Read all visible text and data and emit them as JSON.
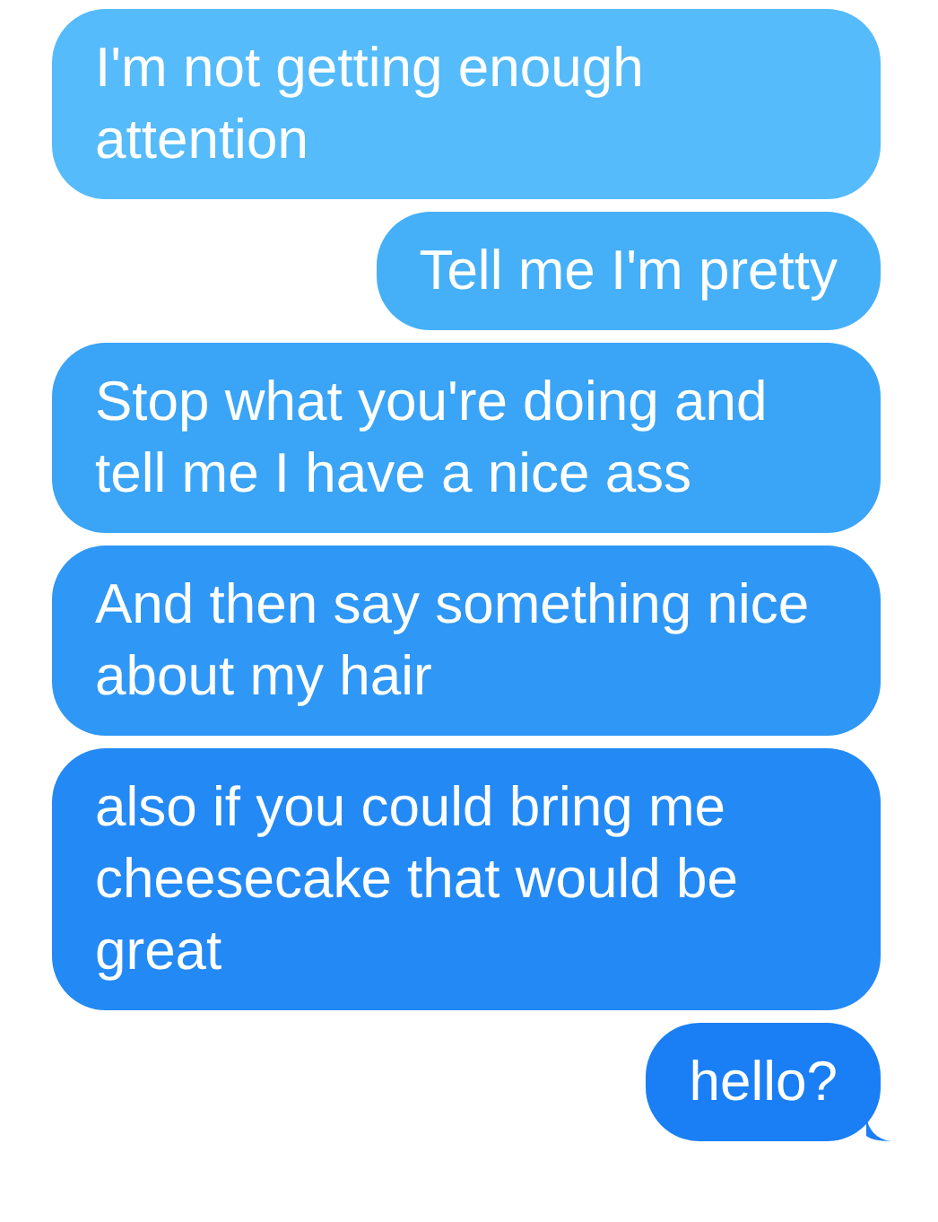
{
  "messages": [
    {
      "text": "I'm not getting enough attention"
    },
    {
      "text": "Tell me I'm pretty"
    },
    {
      "text": "Stop what you're doing and tell me I have a nice ass"
    },
    {
      "text": "And then say something nice about my hair"
    },
    {
      "text": "also if you could bring me cheesecake that would be great"
    },
    {
      "text": "hello?"
    }
  ]
}
